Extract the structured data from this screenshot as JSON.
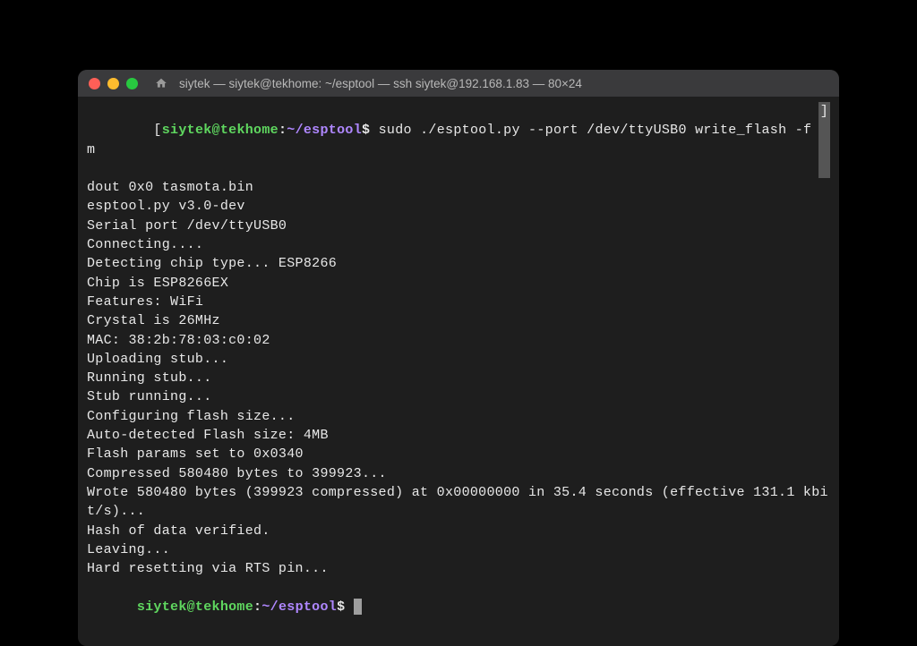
{
  "window": {
    "title": "siytek — siytek@tekhome: ~/esptool — ssh siytek@192.168.1.83 — 80×24"
  },
  "prompt": {
    "user_host": "siytek@tekhome",
    "separator": ":",
    "path": "~/esptool",
    "symbol": "$"
  },
  "command": {
    "line1": "sudo ./esptool.py --port /dev/ttyUSB0 write_flash -fm",
    "line2": "dout 0x0 tasmota.bin",
    "scroll_char": "]"
  },
  "output": [
    "esptool.py v3.0-dev",
    "Serial port /dev/ttyUSB0",
    "Connecting....",
    "Detecting chip type... ESP8266",
    "Chip is ESP8266EX",
    "Features: WiFi",
    "Crystal is 26MHz",
    "MAC: 38:2b:78:03:c0:02",
    "Uploading stub...",
    "Running stub...",
    "Stub running...",
    "Configuring flash size...",
    "Auto-detected Flash size: 4MB",
    "Flash params set to 0x0340",
    "Compressed 580480 bytes to 399923...",
    "Wrote 580480 bytes (399923 compressed) at 0x00000000 in 35.4 seconds (effective 131.1 kbit/s)...",
    "Hash of data verified.",
    "",
    "Leaving...",
    "Hard resetting via RTS pin..."
  ]
}
